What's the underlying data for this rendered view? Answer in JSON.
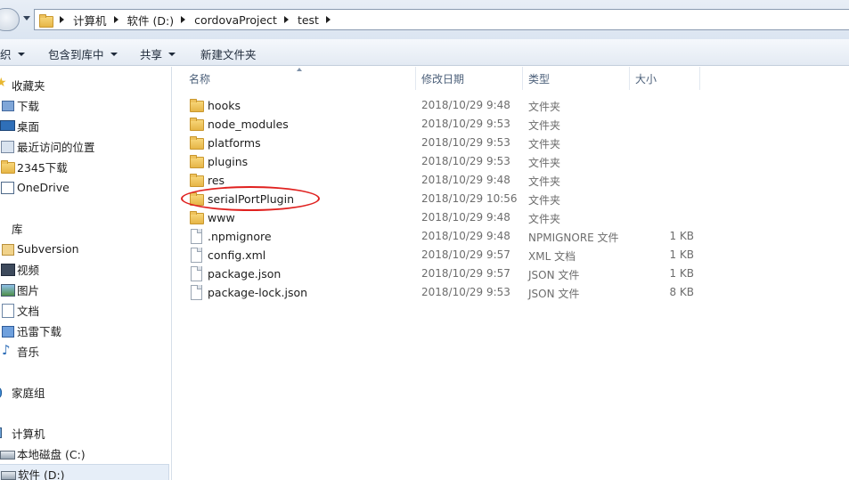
{
  "address": {
    "crumbs": [
      "计算机",
      "软件 (D:)",
      "cordovaProject",
      "test"
    ]
  },
  "toolbar": {
    "organize": "织",
    "include_library": "包含到库中",
    "share": "共享",
    "new_folder": "新建文件夹"
  },
  "navpane": {
    "favorites": "收藏夹",
    "downloads": "下载",
    "desktop": "桌面",
    "recent": "最近访问的位置",
    "dl2345": "2345下载",
    "onedrive": "OneDrive",
    "libraries": "库",
    "subversion": "Subversion",
    "videos": "视频",
    "pictures": "图片",
    "documents": "文档",
    "xunlei": "迅雷下载",
    "music": "音乐",
    "homegroup": "家庭组",
    "computer": "计算机",
    "drive_c": "本地磁盘 (C:)",
    "drive_d": "软件 (D:)"
  },
  "columns": {
    "name": "名称",
    "date": "修改日期",
    "type": "类型",
    "size": "大小"
  },
  "files": [
    {
      "name": "hooks",
      "date": "2018/10/29 9:48",
      "type": "文件夹",
      "size": "",
      "kind": "folder"
    },
    {
      "name": "node_modules",
      "date": "2018/10/29 9:53",
      "type": "文件夹",
      "size": "",
      "kind": "folder"
    },
    {
      "name": "platforms",
      "date": "2018/10/29 9:53",
      "type": "文件夹",
      "size": "",
      "kind": "folder"
    },
    {
      "name": "plugins",
      "date": "2018/10/29 9:53",
      "type": "文件夹",
      "size": "",
      "kind": "folder"
    },
    {
      "name": "res",
      "date": "2018/10/29 9:48",
      "type": "文件夹",
      "size": "",
      "kind": "folder"
    },
    {
      "name": "serialPortPlugin",
      "date": "2018/10/29 10:56",
      "type": "文件夹",
      "size": "",
      "kind": "folder"
    },
    {
      "name": "www",
      "date": "2018/10/29 9:48",
      "type": "文件夹",
      "size": "",
      "kind": "folder"
    },
    {
      "name": ".npmignore",
      "date": "2018/10/29 9:48",
      "type": "NPMIGNORE 文件",
      "size": "1 KB",
      "kind": "file"
    },
    {
      "name": "config.xml",
      "date": "2018/10/29 9:57",
      "type": "XML 文档",
      "size": "1 KB",
      "kind": "file"
    },
    {
      "name": "package.json",
      "date": "2018/10/29 9:57",
      "type": "JSON 文件",
      "size": "1 KB",
      "kind": "file"
    },
    {
      "name": "package-lock.json",
      "date": "2018/10/29 9:53",
      "type": "JSON 文件",
      "size": "8 KB",
      "kind": "file"
    }
  ],
  "colors": {
    "annotation_circle": "#e0211f",
    "folder": "#e6b547",
    "selected_nav": "#e6eef8"
  }
}
